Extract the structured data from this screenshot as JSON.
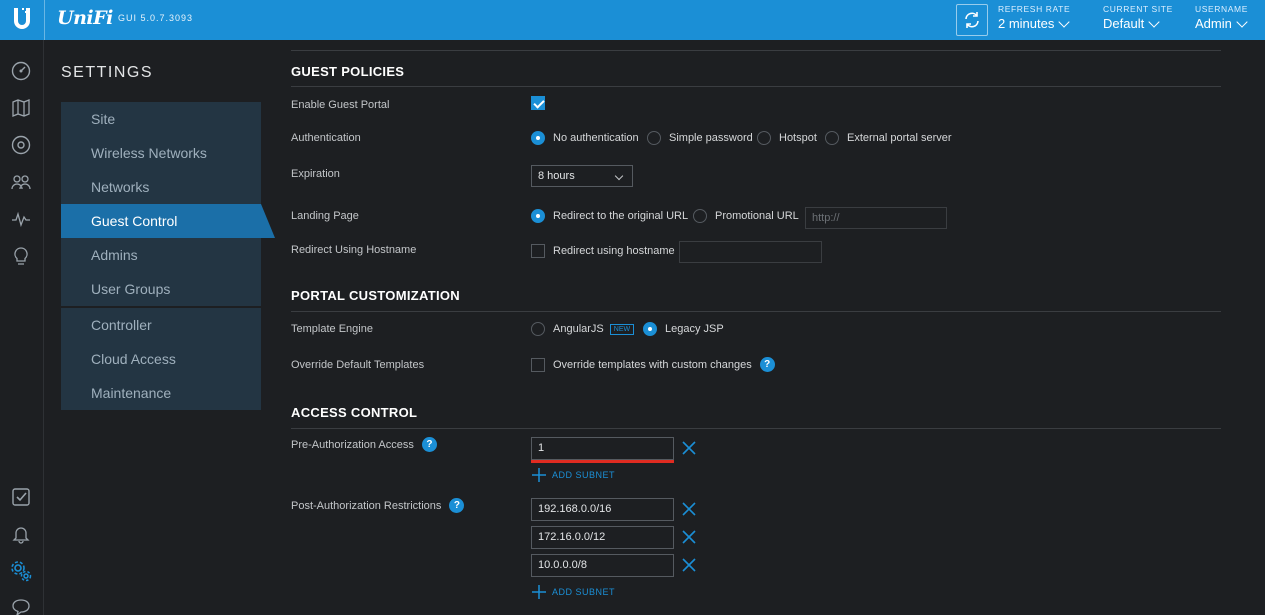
{
  "topbar": {
    "brand": "UniFi",
    "gui_version": "GUI 5.0.7.3093",
    "refresh_rate": {
      "label": "REFRESH RATE",
      "value": "2 minutes"
    },
    "current_site": {
      "label": "CURRENT SITE",
      "value": "Default"
    },
    "username": {
      "label": "USERNAME",
      "value": "Admin"
    }
  },
  "rail": {
    "icons": [
      "dashboard-icon",
      "map-icon",
      "devices-icon",
      "clients-icon",
      "statistics-icon",
      "insights-icon",
      "events-icon",
      "alerts-icon",
      "settings-icon",
      "chat-icon"
    ]
  },
  "settings": {
    "title": "SETTINGS",
    "nav_group1": [
      "Site",
      "Wireless Networks",
      "Networks",
      "Guest Control",
      "Admins",
      "User Groups"
    ],
    "nav_group2": [
      "Controller",
      "Cloud Access",
      "Maintenance"
    ],
    "active_item": "Guest Control"
  },
  "guest_policies": {
    "title": "GUEST POLICIES",
    "enable_portal_label": "Enable Guest Portal",
    "enable_portal_checked": true,
    "authentication_label": "Authentication",
    "auth_options": [
      "No authentication",
      "Simple password",
      "Hotspot",
      "External portal server"
    ],
    "auth_selected": "No authentication",
    "expiration_label": "Expiration",
    "expiration_value": "8 hours",
    "landing_label": "Landing Page",
    "landing_options": [
      "Redirect to the original URL",
      "Promotional URL"
    ],
    "landing_selected": "Redirect to the original URL",
    "promo_url_placeholder": "http://",
    "redirect_hostname_label": "Redirect Using Hostname",
    "redirect_hostname_option": "Redirect using hostname",
    "redirect_hostname_checked": false
  },
  "portal_customization": {
    "title": "PORTAL CUSTOMIZATION",
    "template_engine_label": "Template Engine",
    "engine_options": [
      "AngularJS",
      "Legacy JSP"
    ],
    "new_badge": "NEW",
    "engine_selected": "Legacy JSP",
    "override_label": "Override Default Templates",
    "override_option": "Override templates with custom changes",
    "override_checked": false,
    "help_glyph": "?"
  },
  "access_control": {
    "title": "ACCESS CONTROL",
    "pre_auth_label": "Pre-Authorization Access",
    "pre_auth_values": [
      "1"
    ],
    "post_auth_label": "Post-Authorization Restrictions",
    "post_auth_values": [
      "192.168.0.0/16",
      "172.16.0.0/12",
      "10.0.0.0/8"
    ],
    "add_subnet_label": "ADD SUBNET",
    "help_glyph": "?"
  },
  "colors": {
    "accent": "#1b8fd6",
    "error": "#e02b21",
    "nav_active": "#1b6fa8",
    "nav_bg": "#233543",
    "background": "#1d1f22"
  }
}
